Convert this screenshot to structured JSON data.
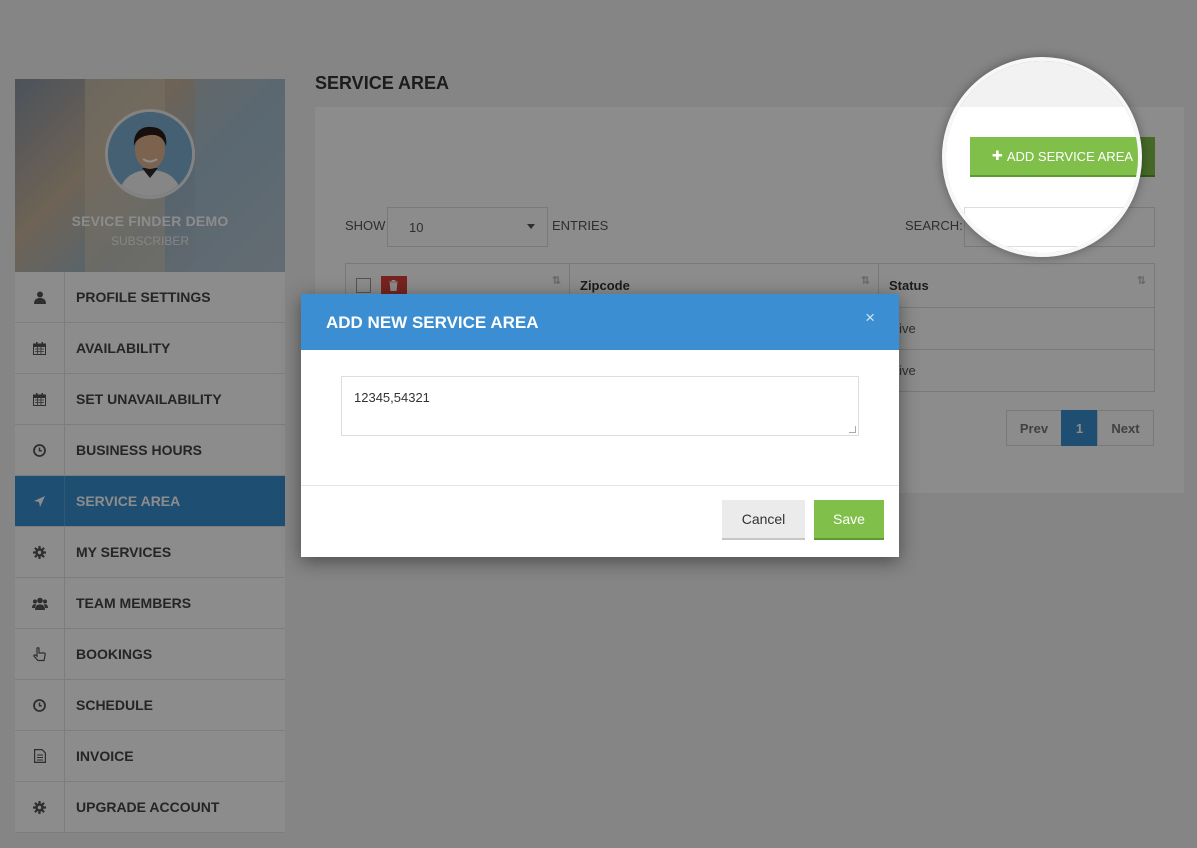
{
  "profile": {
    "name": "SEVICE FINDER DEMO",
    "role": "SUBSCRIBER"
  },
  "sidebar": {
    "items": [
      {
        "label": "PROFILE SETTINGS",
        "icon": "user-icon"
      },
      {
        "label": "AVAILABILITY",
        "icon": "calendar-icon"
      },
      {
        "label": "SET UNAVAILABILITY",
        "icon": "calendar-icon"
      },
      {
        "label": "BUSINESS HOURS",
        "icon": "clock-icon"
      },
      {
        "label": "SERVICE AREA",
        "icon": "location-arrow-icon",
        "active": true
      },
      {
        "label": "MY SERVICES",
        "icon": "gear-icon"
      },
      {
        "label": "TEAM MEMBERS",
        "icon": "users-icon"
      },
      {
        "label": "BOOKINGS",
        "icon": "hand-pointer-icon"
      },
      {
        "label": "SCHEDULE",
        "icon": "clock-icon"
      },
      {
        "label": "INVOICE",
        "icon": "document-icon"
      },
      {
        "label": "UPGRADE ACCOUNT",
        "icon": "gear-icon"
      }
    ]
  },
  "main": {
    "title": "SERVICE AREA",
    "add_button": "ADD SERVICE AREA",
    "show_label": "SHOW",
    "entries_value": "10",
    "entries_label": "ENTRIES",
    "search_label": "SEARCH:",
    "table": {
      "headers": [
        "",
        "Zipcode",
        "Status"
      ],
      "rows": [
        {
          "status": "ctive"
        },
        {
          "status": "ctive"
        }
      ]
    },
    "pagination": {
      "prev": "Prev",
      "current": "1",
      "next": "Next"
    }
  },
  "modal": {
    "title": "ADD NEW SERVICE AREA",
    "close": "×",
    "zip_value": "12345,54321",
    "cancel": "Cancel",
    "save": "Save"
  },
  "colors": {
    "accent_blue": "#3a8ed1",
    "accent_green": "#80c04a",
    "danger_red": "#d9403a"
  }
}
